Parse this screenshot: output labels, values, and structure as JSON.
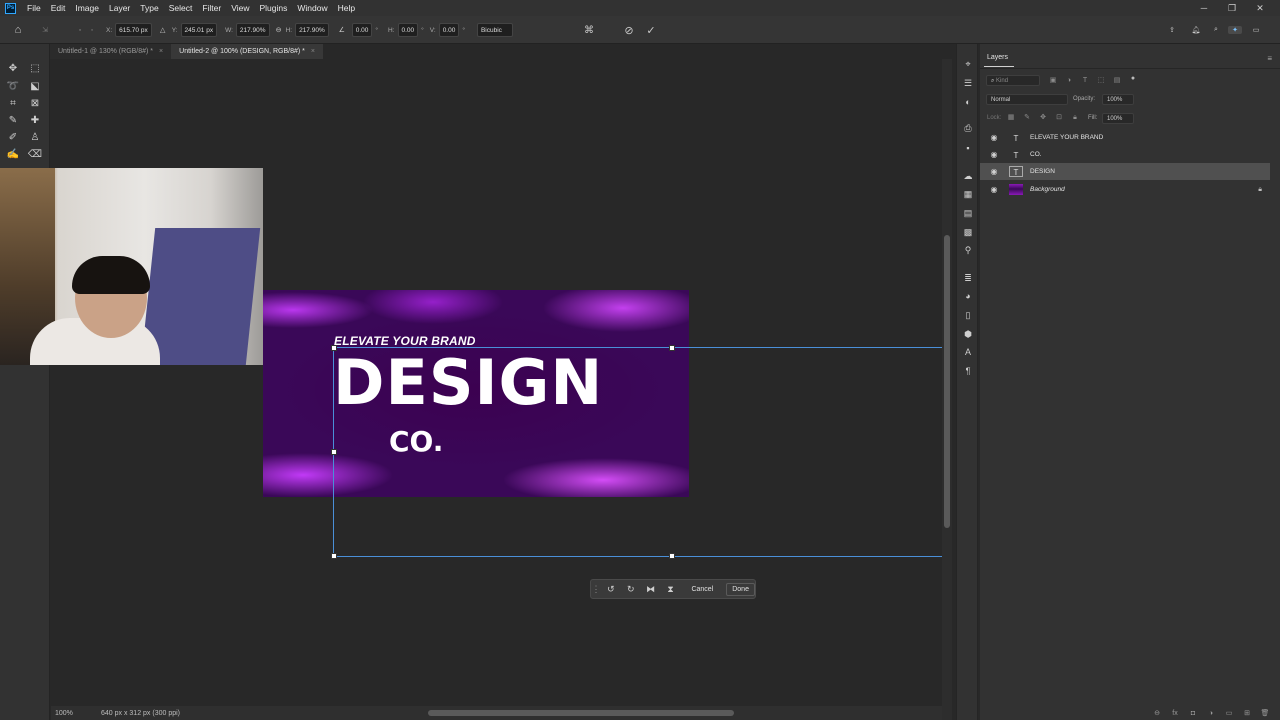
{
  "app": {
    "logo_text": "Ps"
  },
  "menu": [
    "File",
    "Edit",
    "Image",
    "Layer",
    "Type",
    "Select",
    "Filter",
    "View",
    "Plugins",
    "Window",
    "Help"
  ],
  "window_controls": {
    "minimize": "─",
    "restore": "❐",
    "close": "✕"
  },
  "options_bar": {
    "x_label": "X:",
    "x_value": "615.70 px",
    "y_label": "Y:",
    "y_value": "245.01 px",
    "w_label": "W:",
    "w_value": "217.90%",
    "h_label": "H:",
    "h_value": "217.90%",
    "angle_value": "0.00",
    "angle_unit": "°",
    "hskew_label": "H:",
    "hskew_value": "0.00",
    "vskew_label": "V:",
    "vskew_value": "0.00",
    "interpolation": "Bicubic",
    "cancel_icon": "cancel-transform-icon",
    "commit_icon": "commit-transform-icon"
  },
  "tabs": [
    {
      "label": "Untitled-1 @ 130% (RGB/8#) *",
      "close": "×",
      "active": false
    },
    {
      "label": "Untitled-2 @ 100% (DESIGN, RGB/8#) *",
      "close": "×",
      "active": true
    }
  ],
  "artwork": {
    "tagline": "ELEVATE YOUR BRAND",
    "headline": "DESIGN",
    "subline": "CO."
  },
  "task_bar": {
    "cancel": "Cancel",
    "done": "Done"
  },
  "status": {
    "zoom": "100%",
    "doc_info": "640 px x 312 px (300 ppi)"
  },
  "layers_panel": {
    "title": "Layers",
    "search_placeholder": "Kind",
    "blend_mode": "Normal",
    "opacity_label": "Opacity:",
    "opacity_value": "100%",
    "lock_label": "Lock:",
    "fill_label": "Fill:",
    "fill_value": "100%",
    "layers": [
      {
        "name": "ELEVATE YOUR BRAND",
        "kind": "text",
        "selected": false
      },
      {
        "name": "CO.",
        "kind": "text",
        "selected": false
      },
      {
        "name": "DESIGN",
        "kind": "text",
        "selected": true
      },
      {
        "name": "Background",
        "kind": "image",
        "selected": false,
        "locked": true
      }
    ]
  },
  "colors": {
    "accent": "#31a8ff",
    "transform_line": "#4a8fd8",
    "artboard_base": "#3a0858",
    "glow": "#c83cff"
  }
}
